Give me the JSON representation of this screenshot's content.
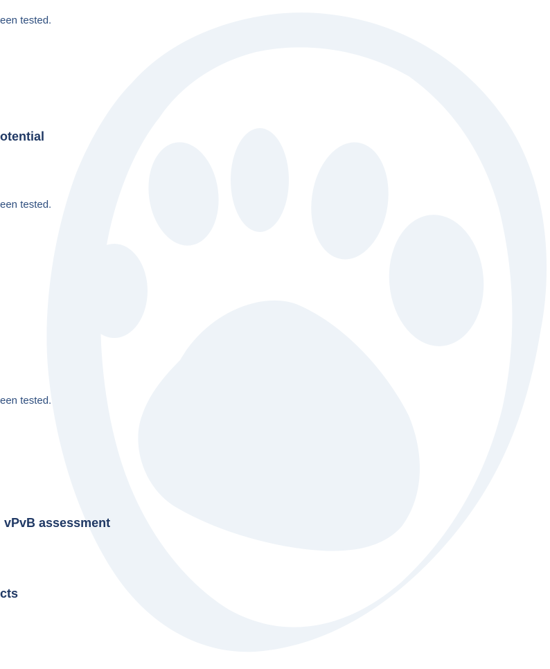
{
  "lines": [
    {
      "kind": "body",
      "text": "een tested."
    },
    {
      "kind": "heading",
      "text": "otential"
    },
    {
      "kind": "body",
      "text": "een tested."
    },
    {
      "kind": "body",
      "text": "een tested."
    },
    {
      "kind": "heading",
      "text": "vPvB assessment"
    },
    {
      "kind": "heading",
      "text": "cts"
    }
  ],
  "colors": {
    "heading": "#1f3864",
    "body": "#2e4e7e",
    "watermark": "#eef3f8"
  },
  "watermark_icon": "paw-print-icon"
}
